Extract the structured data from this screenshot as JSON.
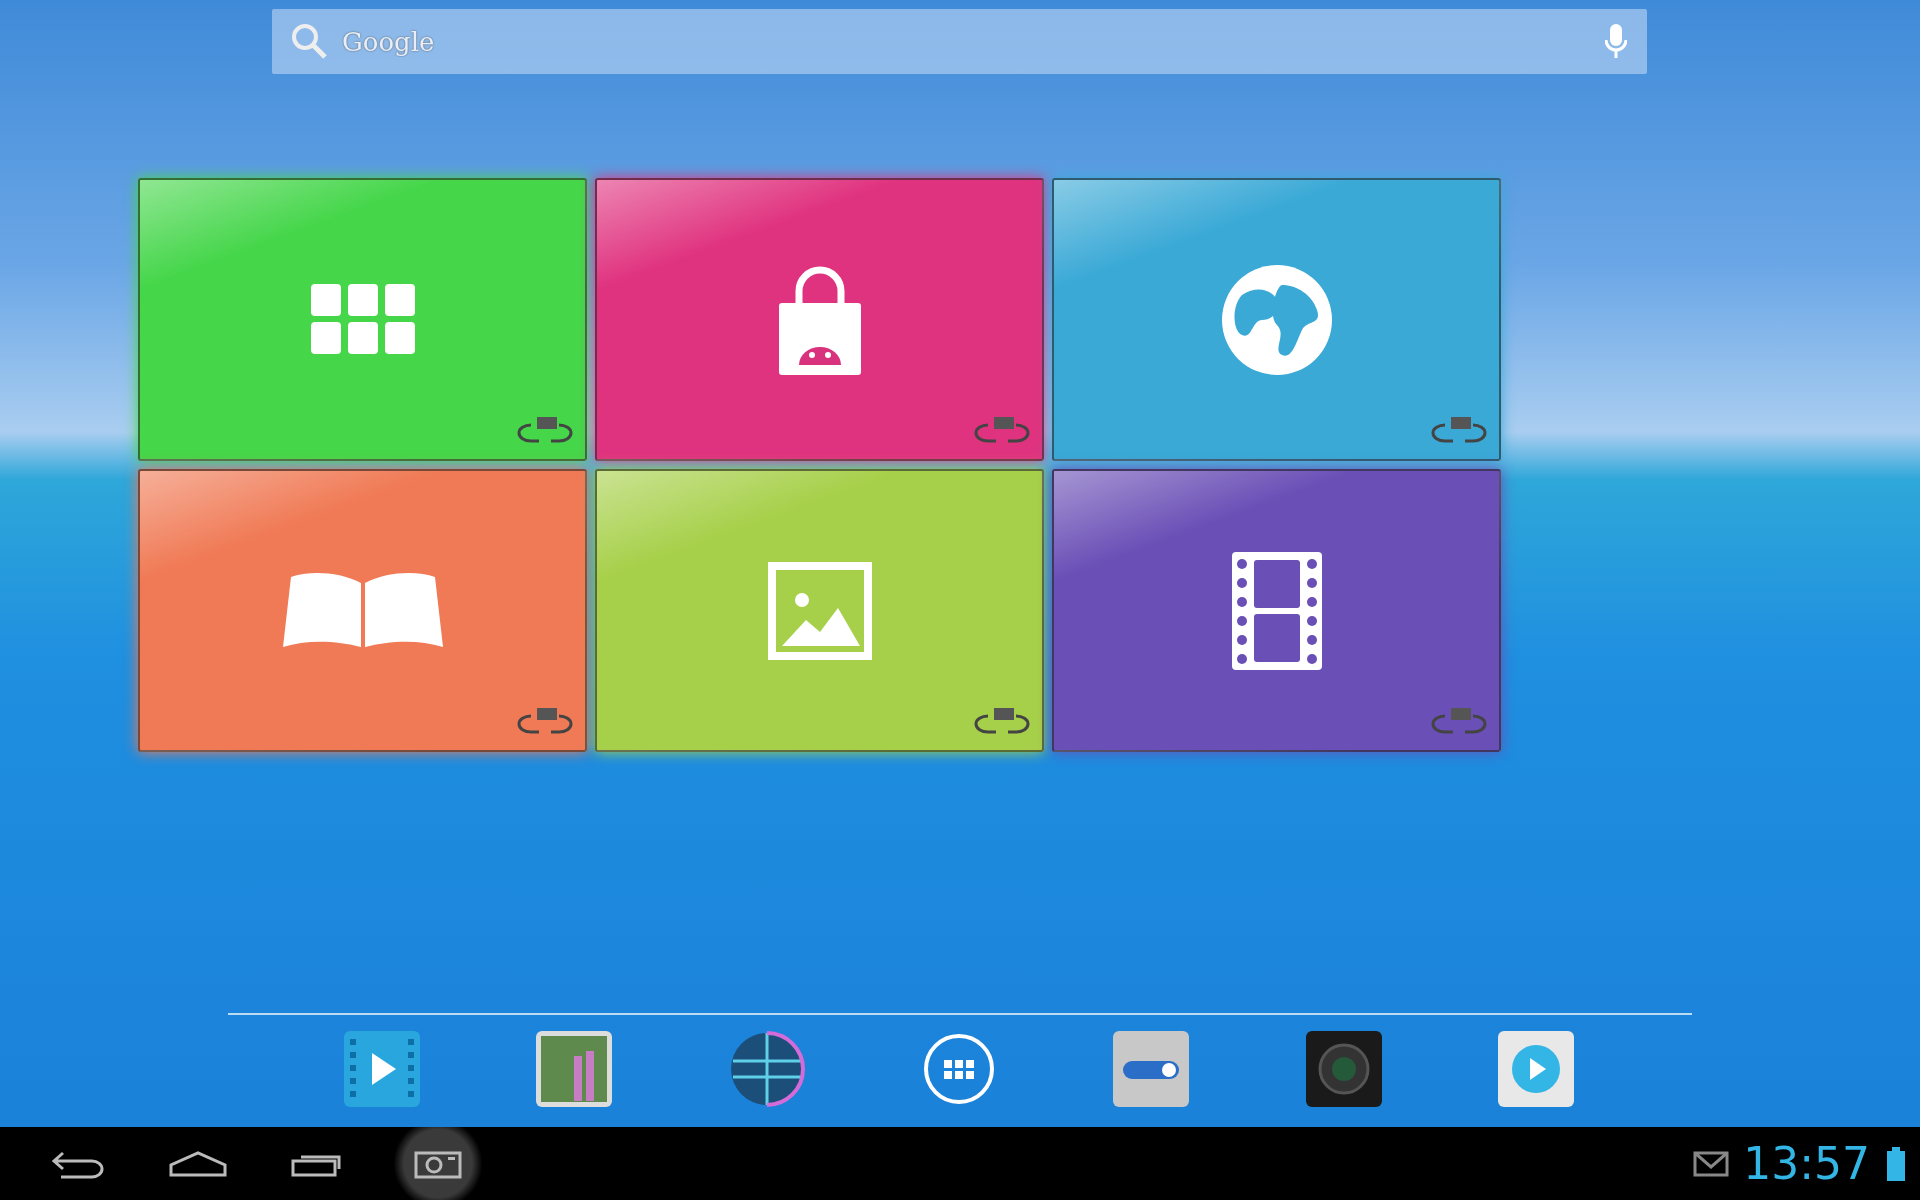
{
  "search": {
    "placeholder": "Google"
  },
  "tiles": [
    {
      "kind": "apps",
      "color": "#45d64a"
    },
    {
      "kind": "store",
      "color": "#e0337f"
    },
    {
      "kind": "browser",
      "color": "#3aa9d6"
    },
    {
      "kind": "books",
      "color": "#f07a55"
    },
    {
      "kind": "gallery",
      "color": "#a7d04a"
    },
    {
      "kind": "video",
      "color": "#6a4fb6"
    }
  ],
  "dock": [
    {
      "kind": "video"
    },
    {
      "kind": "gallery"
    },
    {
      "kind": "globe"
    },
    {
      "kind": "apps"
    },
    {
      "kind": "toggle"
    },
    {
      "kind": "camera"
    },
    {
      "kind": "player"
    }
  ],
  "status": {
    "time": "13:57"
  }
}
